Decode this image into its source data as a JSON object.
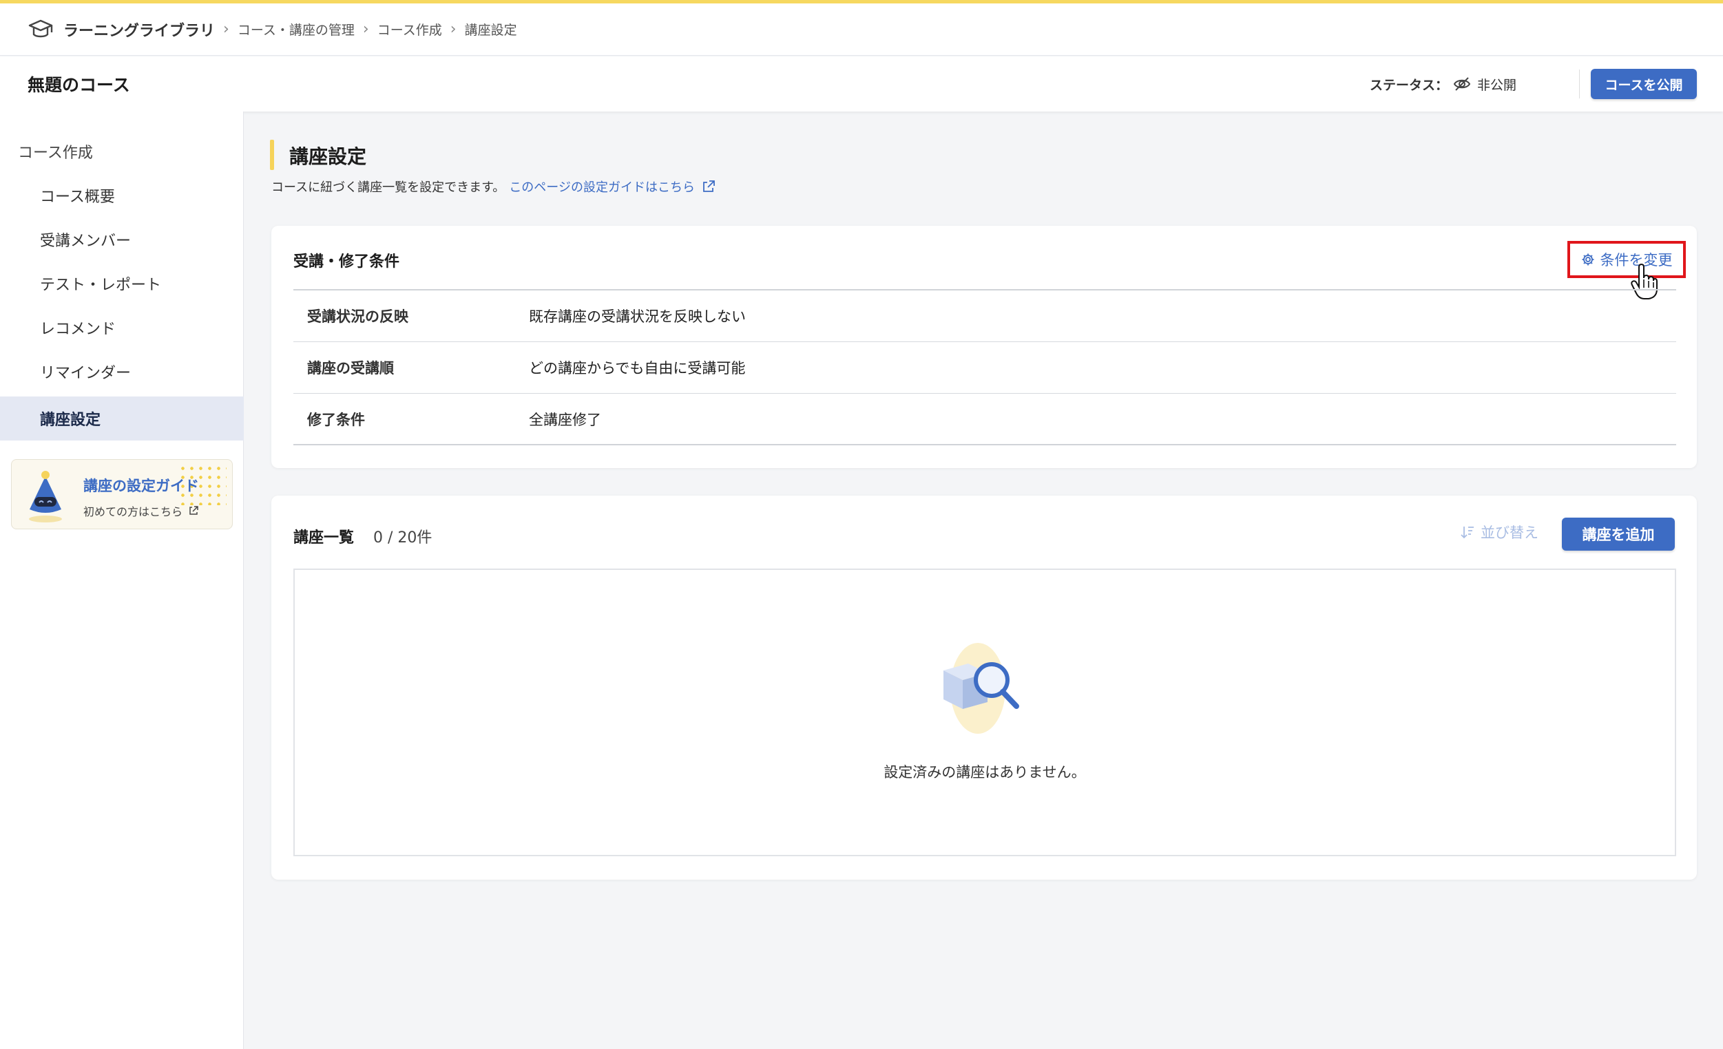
{
  "breadcrumb": {
    "root": "ラーニングライブラリ",
    "items": [
      "コース・講座の管理",
      "コース作成",
      "講座設定"
    ]
  },
  "header": {
    "course_title": "無題のコース",
    "status_label": "ステータス：",
    "status_value": "非公開",
    "publish_label": "コースを公開"
  },
  "sidebar": {
    "section": "コース作成",
    "items": [
      {
        "label": "コース概要",
        "active": false
      },
      {
        "label": "受講メンバー",
        "active": false
      },
      {
        "label": "テスト・レポート",
        "active": false
      },
      {
        "label": "レコメンド",
        "active": false
      },
      {
        "label": "リマインダー",
        "active": false
      },
      {
        "label": "講座設定",
        "active": true
      }
    ],
    "guide": {
      "title": "講座の設定ガイド",
      "subtitle": "初めての方はこちら"
    }
  },
  "main": {
    "title": "講座設定",
    "description": "コースに紐づく講座一覧を設定できます。",
    "guide_link": "このページの設定ガイドはこちら",
    "conditions": {
      "title": "受講・修了条件",
      "change_label": "条件を変更",
      "rows": [
        {
          "label": "受講状況の反映",
          "value": "既存講座の受講状況を反映しない"
        },
        {
          "label": "講座の受講順",
          "value": "どの講座からでも自由に受講可能"
        },
        {
          "label": "修了条件",
          "value": "全講座修了"
        }
      ]
    },
    "lectures": {
      "title": "講座一覧",
      "count": "0 / 20件",
      "sort_label": "並び替え",
      "add_label": "講座を追加",
      "empty_text": "設定済みの講座はありません。"
    }
  },
  "colors": {
    "accent_blue": "#3d6cc4",
    "accent_yellow": "#f6d35a",
    "highlight_red": "#e0161b"
  }
}
